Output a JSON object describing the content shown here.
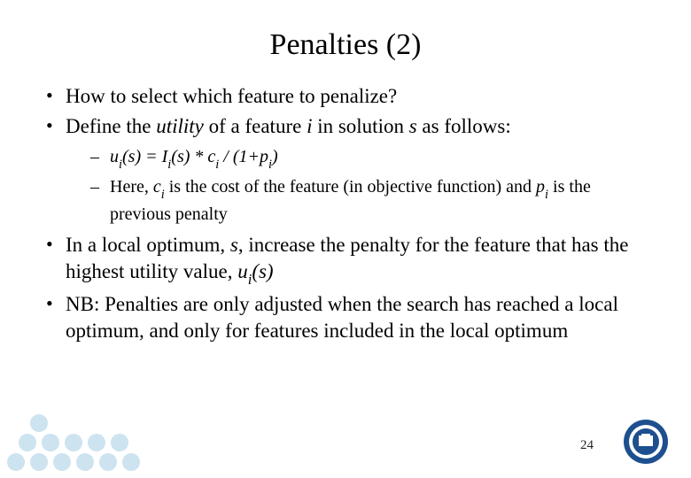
{
  "title": "Penalties (2)",
  "bullets": {
    "b1": "How to select which feature to penalize?",
    "b2_pre": "Define the ",
    "b2_utility": "utility",
    "b2_mid": " of a feature ",
    "b2_i": "i",
    "b2_mid2": " in solution ",
    "b2_s": "s",
    "b2_post": " as follows:",
    "eq_u": "u",
    "eq_i1": "i",
    "eq_paren_s1": "(s)",
    "eq_eq": " = ",
    "eq_I": "I",
    "eq_i2": "i",
    "eq_paren_s2": "(s)",
    "eq_star": " * ",
    "eq_c": "c",
    "eq_i3": "i",
    "eq_div": " / (1+",
    "eq_p": "p",
    "eq_i4": "i",
    "eq_close": ")",
    "sub2_pre": "Here, ",
    "sub2_c": "c",
    "sub2_ci": "i",
    "sub2_mid": " is the cost of the feature (in objective function) and ",
    "sub2_p": "p",
    "sub2_pi": "i",
    "sub2_post": " is the previous penalty",
    "b3_pre": "In a local optimum, ",
    "b3_s": "s",
    "b3_mid": ", increase the penalty for the feature that has the highest utility value, ",
    "b3_u": "u",
    "b3_ui": "i",
    "b3_paren": "(s)",
    "b4": "NB: Penalties are only adjusted when the search has reached a local optimum, and only for features included in the local optimum"
  },
  "page_number": "24",
  "decor": {
    "dot_color": "#cde3f0",
    "logo_ring": "#1e4f8f",
    "logo_inner": "#ffffff"
  }
}
